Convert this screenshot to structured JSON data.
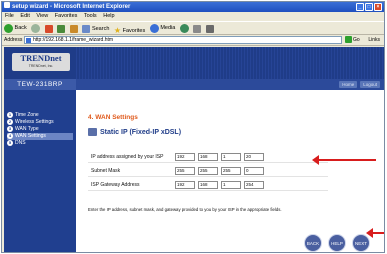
{
  "window": {
    "title": "setup wizard - Microsoft Internet Explorer"
  },
  "menu": [
    "File",
    "Edit",
    "View",
    "Favorites",
    "Tools",
    "Help"
  ],
  "toolbar": {
    "back": "Back",
    "search": "Search",
    "favorites": "Favorites",
    "media": "Media"
  },
  "address": {
    "label": "Address",
    "url": "http://192.168.1.1/frame_wizard.htm",
    "go": "Go",
    "links": "Links"
  },
  "header": {
    "brand": "TRENDnet",
    "tagline": "TRENDnet, Inc.",
    "model": "TEW-231BRP",
    "home": "Home",
    "logout": "Logout"
  },
  "sidebar": {
    "items": [
      {
        "num": "1",
        "label": "Time Zone"
      },
      {
        "num": "2",
        "label": "Wireless Settings"
      },
      {
        "num": "3",
        "label": "WAN Type"
      },
      {
        "num": "4",
        "label": "WAN Settings"
      },
      {
        "num": "5",
        "label": "DNS"
      }
    ]
  },
  "main": {
    "heading": "4. WAN Settings",
    "section": "Static IP (Fixed-IP xDSL)",
    "rows": [
      {
        "label": "IP address assigned by your ISP",
        "values": [
          "192",
          "168",
          "1",
          "20"
        ]
      },
      {
        "label": "Subnet Mask",
        "values": [
          "255",
          "255",
          "255",
          "0"
        ]
      },
      {
        "label": "ISP Gateway Address",
        "values": [
          "192",
          "168",
          "1",
          "254"
        ]
      }
    ],
    "note": "Enter the IP address, subnet mask, and gateway provided to you by your ISP in the appropriate fields."
  },
  "buttons": {
    "back": "BACK",
    "help": "HELP",
    "next": "NEXT"
  },
  "colors": {
    "brand": "#1f3c88",
    "accent": "#e05a1c",
    "arrow": "#d81d1d"
  }
}
